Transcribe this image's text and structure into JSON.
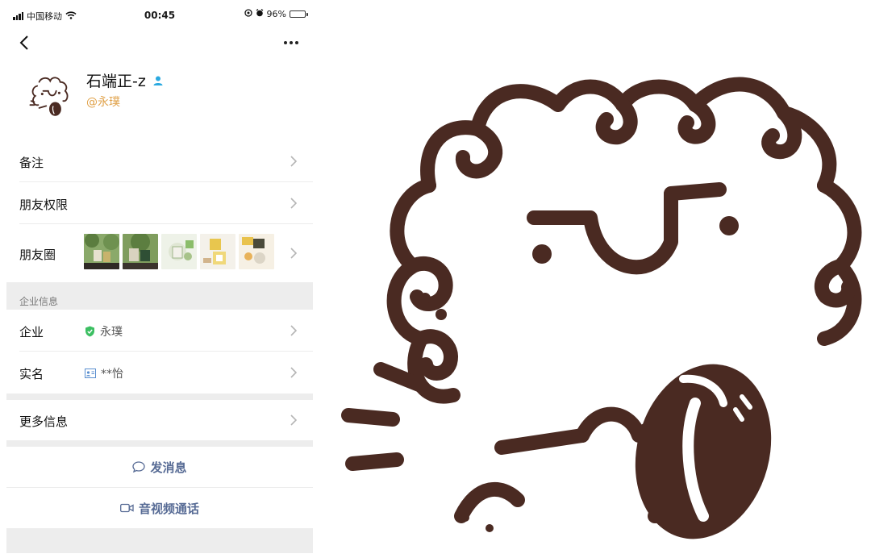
{
  "status_bar": {
    "carrier": "中国移动",
    "time": "00:45",
    "battery_percent": "96%",
    "battery_level": 0.96
  },
  "nav": {
    "back_icon": "chevron-left-icon",
    "more_icon": "ellipsis-icon"
  },
  "profile": {
    "name": "石端正-z",
    "corp": "@永璞",
    "verified_icon": "person-icon",
    "accent_color": "#e0a24a"
  },
  "rows": {
    "remark_label": "备注",
    "permission_label": "朋友权限",
    "moments_label": "朋友圈",
    "corp_section_label": "企业信息",
    "corp_label": "企业",
    "corp_value": "永璞",
    "realname_label": "实名",
    "realname_value": "**怡",
    "more_info_label": "更多信息"
  },
  "actions": {
    "message_label": "发消息",
    "call_label": "音视频通话",
    "link_color": "#576b95"
  },
  "colors": {
    "avatar_brown": "#4a2a22",
    "verified_green": "#3cbf62",
    "section_gray": "#ededed"
  }
}
